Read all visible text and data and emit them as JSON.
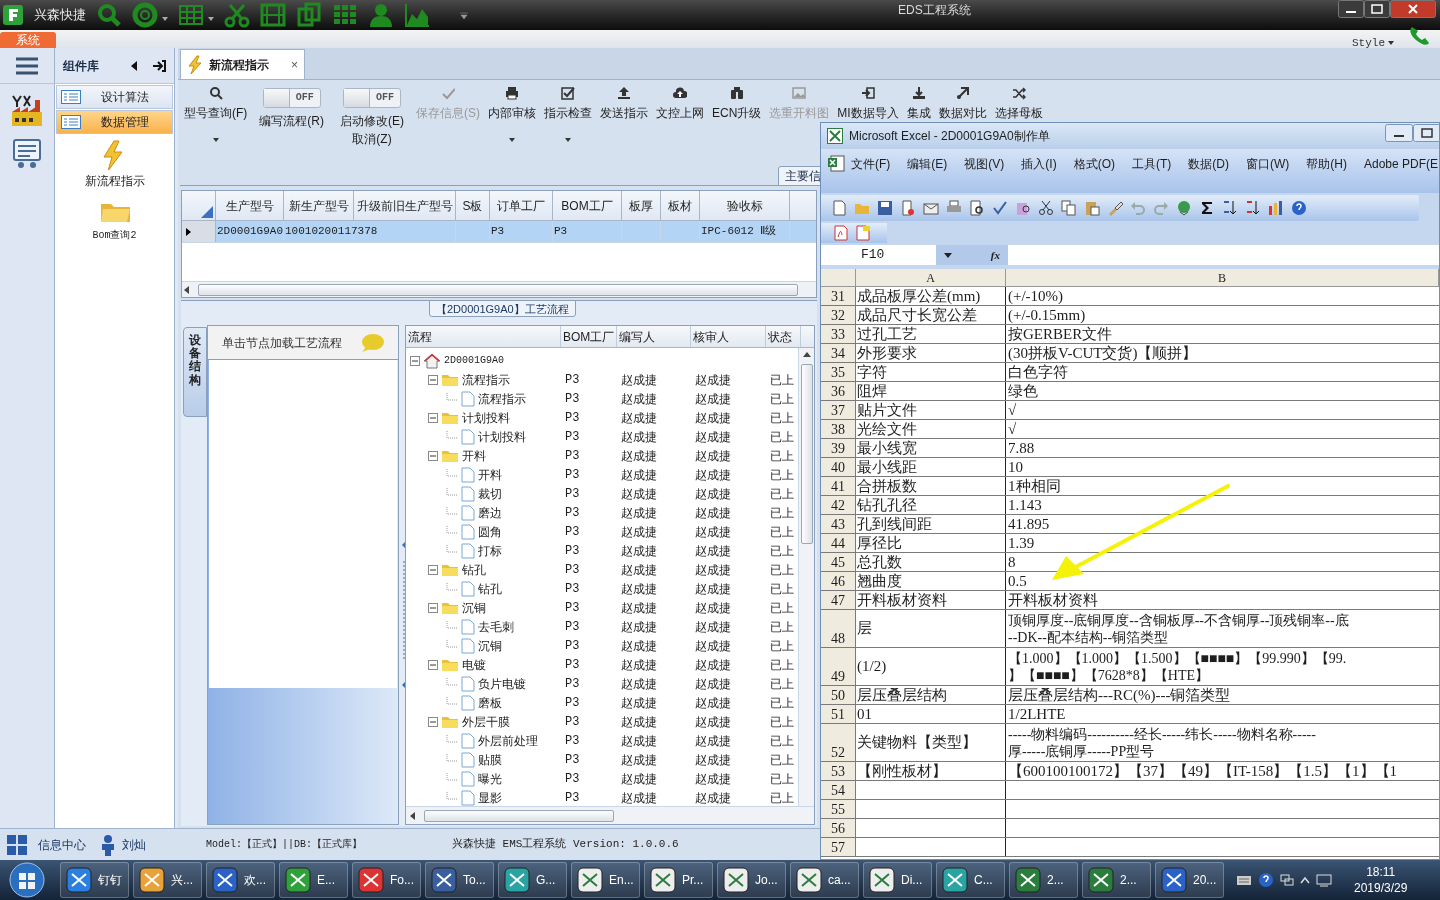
{
  "app": {
    "quick_title": "兴森快捷",
    "title": "EDS工程系统",
    "menu_tab": "系统",
    "style_label": "Style"
  },
  "component_panel": {
    "title": "组件库",
    "items": [
      {
        "label": "设计算法",
        "selected": false
      },
      {
        "label": "数据管理",
        "selected": true
      }
    ],
    "tiles": [
      {
        "label": "新流程指示"
      },
      {
        "label": "Bom查询2"
      }
    ]
  },
  "doc_tab": {
    "label": "新流程指示",
    "close": "×"
  },
  "toolbar": [
    {
      "kind": "button",
      "label": "型号查询(F)",
      "disabled": false,
      "dropdown": true
    },
    {
      "kind": "toggle",
      "label": "编写流程(R)",
      "text": "OFF",
      "on": false
    },
    {
      "kind": "toggle",
      "label": "启动修改(E)",
      "label2": "取消(Z)",
      "text": "OFF",
      "on": false
    },
    {
      "kind": "button",
      "label": "保存信息(S)",
      "disabled": true,
      "dropdown": false
    },
    {
      "kind": "button",
      "label": "内部审核",
      "disabled": false,
      "dropdown": true
    },
    {
      "kind": "button",
      "label": "指示检查",
      "disabled": false,
      "dropdown": true
    },
    {
      "kind": "button",
      "label": "发送指示",
      "disabled": false,
      "dropdown": false
    },
    {
      "kind": "button",
      "label": "文控上网",
      "disabled": false,
      "dropdown": false
    },
    {
      "kind": "button",
      "label": "ECN升级",
      "disabled": false,
      "dropdown": false
    },
    {
      "kind": "button",
      "label": "选重开料图",
      "disabled": true,
      "dropdown": false
    },
    {
      "kind": "button",
      "label": "MI数据导入",
      "disabled": false,
      "dropdown": false
    },
    {
      "kind": "button",
      "label": "集成",
      "disabled": false,
      "dropdown": false
    },
    {
      "kind": "button",
      "label": "数据对比",
      "disabled": false,
      "dropdown": false
    },
    {
      "kind": "button",
      "label": "选择母板",
      "disabled": false,
      "dropdown": false
    }
  ],
  "group_label": "主要信",
  "table": {
    "columns": [
      "生产型号",
      "新生产型号",
      "升级前旧生产型号",
      "S板",
      "订单工厂",
      "BOM工厂",
      "板厚",
      "板材",
      "验收标"
    ],
    "rows": [
      {
        "selected": true,
        "cells": [
          "2D0001G9A0",
          "10010200117378",
          null,
          null,
          "P3",
          "P3",
          null,
          null,
          "IPC-6012 Ⅱ级"
        ]
      }
    ]
  },
  "process_panel": {
    "title": "【2D0001G9A0】工艺流程",
    "side_tab": "设备结构",
    "hint": "单击节点加载工艺流程",
    "columns": [
      "流程",
      "BOM工厂",
      "编写人",
      "核审人",
      "状态"
    ],
    "tree": [
      {
        "label": "2D0001G9A0",
        "expanded": true,
        "children": [
          {
            "label": "流程指示",
            "bom": "P3",
            "writer": "赵成捷",
            "reviewer": "赵成捷",
            "status": "已上",
            "expanded": true,
            "children": [
              {
                "label": "流程指示",
                "bom": "P3",
                "writer": "赵成捷",
                "reviewer": "赵成捷",
                "status": "已上"
              }
            ]
          },
          {
            "label": "计划投料",
            "bom": "P3",
            "writer": "赵成捷",
            "reviewer": "赵成捷",
            "status": "已上",
            "expanded": true,
            "children": [
              {
                "label": "计划投料",
                "bom": "P3",
                "writer": "赵成捷",
                "reviewer": "赵成捷",
                "status": "已上"
              }
            ]
          },
          {
            "label": "开料",
            "bom": "P3",
            "writer": "赵成捷",
            "reviewer": "赵成捷",
            "status": "已上",
            "expanded": true,
            "children": [
              {
                "label": "开料",
                "bom": "P3",
                "writer": "赵成捷",
                "reviewer": "赵成捷",
                "status": "已上"
              },
              {
                "label": "裁切",
                "bom": "P3",
                "writer": "赵成捷",
                "reviewer": "赵成捷",
                "status": "已上"
              },
              {
                "label": "磨边",
                "bom": "P3",
                "writer": "赵成捷",
                "reviewer": "赵成捷",
                "status": "已上"
              },
              {
                "label": "圆角",
                "bom": "P3",
                "writer": "赵成捷",
                "reviewer": "赵成捷",
                "status": "已上"
              },
              {
                "label": "打标",
                "bom": "P3",
                "writer": "赵成捷",
                "reviewer": "赵成捷",
                "status": "已上"
              }
            ]
          },
          {
            "label": "钻孔",
            "bom": "P3",
            "writer": "赵成捷",
            "reviewer": "赵成捷",
            "status": "已上",
            "expanded": true,
            "children": [
              {
                "label": "钻孔",
                "bom": "P3",
                "writer": "赵成捷",
                "reviewer": "赵成捷",
                "status": "已上"
              }
            ]
          },
          {
            "label": "沉铜",
            "bom": "P3",
            "writer": "赵成捷",
            "reviewer": "赵成捷",
            "status": "已上",
            "expanded": true,
            "children": [
              {
                "label": "去毛刺",
                "bom": "P3",
                "writer": "赵成捷",
                "reviewer": "赵成捷",
                "status": "已上"
              },
              {
                "label": "沉铜",
                "bom": "P3",
                "writer": "赵成捷",
                "reviewer": "赵成捷",
                "status": "已上"
              }
            ]
          },
          {
            "label": "电镀",
            "bom": "P3",
            "writer": "赵成捷",
            "reviewer": "赵成捷",
            "status": "已上",
            "expanded": true,
            "children": [
              {
                "label": "负片电镀",
                "bom": "P3",
                "writer": "赵成捷",
                "reviewer": "赵成捷",
                "status": "已上"
              },
              {
                "label": "磨板",
                "bom": "P3",
                "writer": "赵成捷",
                "reviewer": "赵成捷",
                "status": "已上"
              }
            ]
          },
          {
            "label": "外层干膜",
            "bom": "P3",
            "writer": "赵成捷",
            "reviewer": "赵成捷",
            "status": "已上",
            "expanded": true,
            "children": [
              {
                "label": "外层前处理",
                "bom": "P3",
                "writer": "赵成捷",
                "reviewer": "赵成捷",
                "status": "已上"
              },
              {
                "label": "贴膜",
                "bom": "P3",
                "writer": "赵成捷",
                "reviewer": "赵成捷",
                "status": "已上"
              },
              {
                "label": "曝光",
                "bom": "P3",
                "writer": "赵成捷",
                "reviewer": "赵成捷",
                "status": "已上"
              },
              {
                "label": "显影",
                "bom": "P3",
                "writer": "赵成捷",
                "reviewer": "赵成捷",
                "status": "已上"
              }
            ]
          }
        ]
      }
    ]
  },
  "status_bar": {
    "info": "信息中心",
    "user": "刘灿",
    "model": "Model:【正式】||DB:【正式库】",
    "version": "兴森快捷 EMS工程系统 Version: 1.0.0.6"
  },
  "excel": {
    "title": "Microsoft Excel - 2D0001G9A0制作单",
    "menus": [
      "文件(F)",
      "编辑(E)",
      "视图(V)",
      "插入(I)",
      "格式(O)",
      "工具(T)",
      "数据(D)",
      "窗口(W)",
      "帮助(H)",
      "Adobe PDF(E"
    ],
    "name_box": "F10",
    "fx": "fx",
    "columns": [
      "A",
      "B"
    ],
    "rows": [
      {
        "n": "31",
        "a": [
          "成品板厚公差(mm)"
        ],
        "b": [
          "(+/-10%)"
        ]
      },
      {
        "n": "32",
        "a": [
          "成品尺寸长宽公差"
        ],
        "b": [
          "(+/-0.15mm)"
        ]
      },
      {
        "n": "33",
        "a": [
          "过孔工艺"
        ],
        "b": [
          "按GERBER文件"
        ]
      },
      {
        "n": "34",
        "a": [
          "外形要求"
        ],
        "b": [
          "(30拼板V-CUT交货)【顺拼】"
        ]
      },
      {
        "n": "35",
        "a": [
          "字符"
        ],
        "b": [
          "白色字符"
        ]
      },
      {
        "n": "36",
        "a": [
          "阻焊"
        ],
        "b": [
          "绿色"
        ]
      },
      {
        "n": "37",
        "a": [
          "贴片文件"
        ],
        "b": [
          "√"
        ]
      },
      {
        "n": "38",
        "a": [
          "光绘文件"
        ],
        "b": [
          "√"
        ]
      },
      {
        "n": "39",
        "a": [
          "最小线宽"
        ],
        "b": [
          "7.88"
        ]
      },
      {
        "n": "40",
        "a": [
          "最小线距"
        ],
        "b": [
          "10"
        ]
      },
      {
        "n": "41",
        "a": [
          "合拼板数"
        ],
        "b": [
          "1种相同"
        ]
      },
      {
        "n": "42",
        "a": [
          "钻孔孔径"
        ],
        "b": [
          "1.143"
        ]
      },
      {
        "n": "43",
        "a": [
          "孔到线间距"
        ],
        "b": [
          "41.895"
        ]
      },
      {
        "n": "44",
        "a": [
          "厚径比"
        ],
        "b": [
          "1.39"
        ]
      },
      {
        "n": "45",
        "a": [
          "总孔数"
        ],
        "b": [
          "8"
        ]
      },
      {
        "n": "46",
        "a": [
          "翘曲度"
        ],
        "b": [
          "0.5"
        ]
      },
      {
        "n": "47",
        "a": [
          "开料板材资料"
        ],
        "b": [
          "开料板材资料"
        ]
      },
      {
        "n": "48",
        "a": [
          "层"
        ],
        "b": [
          "顶铜厚度--底铜厚度--含铜板厚--不含铜厚--顶残铜率--底",
          "--DK--配本结构--铜箔类型"
        ]
      },
      {
        "n": "49",
        "a": [
          "(1/2)"
        ],
        "b": [
          "【1.000】【1.000】【1.500】【■■■■】【99.990】【99.",
          "】【■■■■】【7628*8】【HTE】"
        ]
      },
      {
        "n": "50",
        "a": [
          "层压叠层结构"
        ],
        "b": [
          "层压叠层结构---RC(%)---铜箔类型"
        ]
      },
      {
        "n": "51",
        "a": [
          "01"
        ],
        "b": [
          "1/2LHTE"
        ]
      },
      {
        "n": "52",
        "a": [
          "关键物料【类型】"
        ],
        "b": [
          "-----物料编码----------经长-----纬长-----物料名称-----",
          "厚-----底铜厚-----PP型号"
        ]
      },
      {
        "n": "53",
        "a": [
          "【刚性板材】"
        ],
        "b": [
          "【600100100172】【37】【49】【IT-158】【1.5】【1】【1"
        ]
      },
      {
        "n": "54"
      },
      {
        "n": "55"
      },
      {
        "n": "56"
      },
      {
        "n": "57"
      }
    ]
  },
  "taskbar": {
    "items": [
      {
        "label": "钉钉"
      },
      {
        "label": "兴..."
      },
      {
        "label": "欢..."
      },
      {
        "label": "E..."
      },
      {
        "label": "Fo..."
      },
      {
        "label": "To..."
      },
      {
        "label": "G..."
      },
      {
        "label": "En..."
      },
      {
        "label": "Pr..."
      },
      {
        "label": "Jo..."
      },
      {
        "label": "ca..."
      },
      {
        "label": "Di..."
      },
      {
        "label": "C..."
      },
      {
        "label": "2..."
      },
      {
        "label": "2..."
      },
      {
        "label": "20..."
      }
    ],
    "time": "18:11",
    "date": "2019/3/29"
  }
}
